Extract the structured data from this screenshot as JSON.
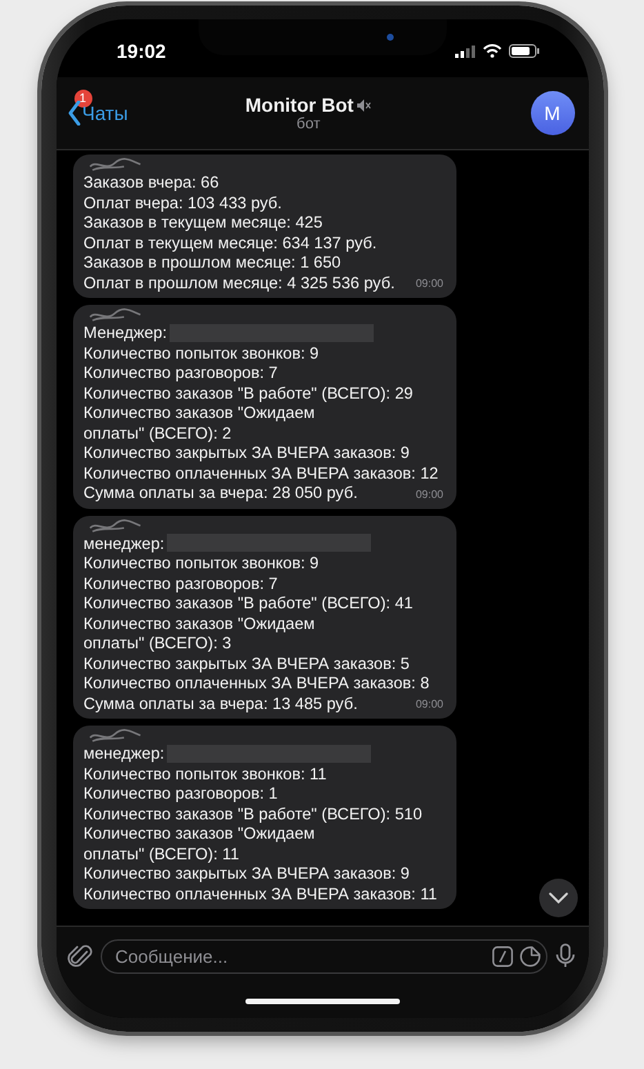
{
  "status_bar": {
    "time": "19:02"
  },
  "header": {
    "back_label": "Чаты",
    "unread_badge": "1",
    "title": "Monitor Bot",
    "muted": true,
    "subtitle": "бот",
    "avatar_letter": "M"
  },
  "messages": [
    {
      "lines": [
        {
          "kind": "text",
          "text": "Заказов вчера: 66"
        },
        {
          "kind": "text",
          "text": "Оплат вчера: 103 433 руб."
        },
        {
          "kind": "text",
          "text": "Заказов в текущем месяце: 425"
        },
        {
          "kind": "text",
          "text": "Оплат в текущем месяце: 634 137 руб."
        },
        {
          "kind": "text",
          "text": "Заказов в прошлом месяце: 1 650"
        },
        {
          "kind": "text",
          "text": "Оплат в прошлом месяце: 4 325 536 руб."
        }
      ],
      "time": "09:00"
    },
    {
      "lines": [
        {
          "kind": "redacted",
          "text": "Менеджер:"
        },
        {
          "kind": "text",
          "text": "Количество попыток звонков: 9"
        },
        {
          "kind": "text",
          "text": "Количество разговоров: 7"
        },
        {
          "kind": "text",
          "text": "Количество заказов \"В работе\" (ВСЕГО): 29"
        },
        {
          "kind": "text",
          "text": "Количество заказов \"Ожидаем"
        },
        {
          "kind": "text",
          "text": "оплаты\" (ВСЕГО): 2"
        },
        {
          "kind": "text",
          "text": "Количество закрытых ЗА ВЧЕРА заказов: 9"
        },
        {
          "kind": "text",
          "text": "Количество оплаченных ЗА ВЧЕРА заказов: 12"
        },
        {
          "kind": "text",
          "text": "Сумма оплаты за вчера: 28 050 руб."
        }
      ],
      "time": "09:00"
    },
    {
      "lines": [
        {
          "kind": "redacted",
          "text": "менеджер:"
        },
        {
          "kind": "text",
          "text": "Количество попыток звонков: 9"
        },
        {
          "kind": "text",
          "text": "Количество разговоров: 7"
        },
        {
          "kind": "text",
          "text": "Количество заказов \"В работе\" (ВСЕГО): 41"
        },
        {
          "kind": "text",
          "text": "Количество заказов \"Ожидаем"
        },
        {
          "kind": "text",
          "text": "оплаты\" (ВСЕГО): 3"
        },
        {
          "kind": "text",
          "text": "Количество закрытых ЗА ВЧЕРА заказов: 5"
        },
        {
          "kind": "text",
          "text": "Количество оплаченных ЗА ВЧЕРА заказов: 8"
        },
        {
          "kind": "text",
          "text": "Сумма оплаты за вчера: 13 485 руб."
        }
      ],
      "time": "09:00"
    },
    {
      "lines": [
        {
          "kind": "redacted",
          "text": "менеджер:"
        },
        {
          "kind": "text",
          "text": "Количество попыток звонков: 11"
        },
        {
          "kind": "text",
          "text": "Количество разговоров: 1"
        },
        {
          "kind": "text",
          "text": "Количество заказов \"В работе\" (ВСЕГО): 510"
        },
        {
          "kind": "text",
          "text": "Количество заказов \"Ожидаем"
        },
        {
          "kind": "text",
          "text": "оплаты\" (ВСЕГО): 11"
        },
        {
          "kind": "text",
          "text": "Количество закрытых ЗА ВЧЕРА заказов: 9"
        },
        {
          "kind": "text",
          "text": "Количество оплаченных ЗА ВЧЕРА заказов: 11"
        }
      ]
    }
  ],
  "composer": {
    "placeholder": "Сообщение..."
  }
}
